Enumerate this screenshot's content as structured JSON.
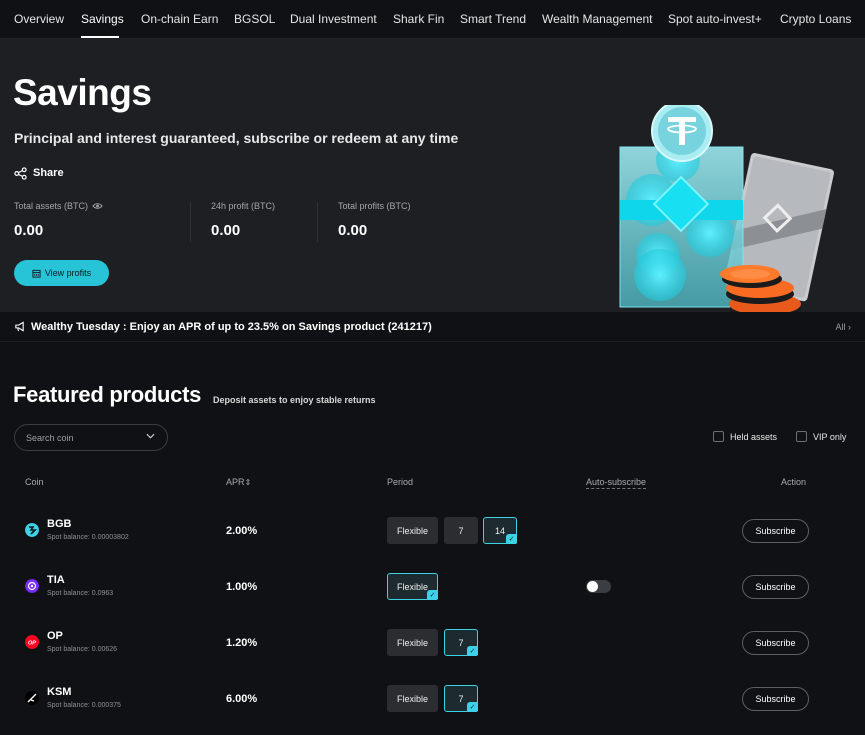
{
  "nav": {
    "items": [
      "Overview",
      "Savings",
      "On-chain Earn",
      "BGSOL",
      "Dual Investment",
      "Shark Fin",
      "Smart Trend",
      "Wealth Management",
      "Spot auto-invest+",
      "Crypto Loans"
    ],
    "active": "Savings"
  },
  "hero": {
    "title": "Savings",
    "subtitle": "Principal and interest guaranteed, subscribe or redeem at any time",
    "share_label": "Share",
    "stats": [
      {
        "label": "Total assets (BTC)",
        "value": "0.00"
      },
      {
        "label": "24h profit (BTC)",
        "value": "0.00"
      },
      {
        "label": "Total profits (BTC)",
        "value": "0.00"
      }
    ],
    "view_profits_label": "View profits"
  },
  "announcement": {
    "text": "Wealthy Tuesday : Enjoy an APR of up to 23.5% on Savings product (241217)",
    "all_label": "All"
  },
  "featured": {
    "title": "Featured products",
    "subtitle": "Deposit assets to enjoy stable returns",
    "search_placeholder": "Search coin",
    "held_assets_label": "Held assets",
    "vip_only_label": "VIP only",
    "columns": {
      "coin": "Coin",
      "apr": "APR",
      "period": "Period",
      "auto": "Auto-subscribe",
      "action": "Action"
    },
    "rows": [
      {
        "coin": "BGB",
        "balance": "Spot balance: 0.00003802",
        "apr": "2.00%",
        "periods": [
          "Flexible",
          "7",
          "14"
        ],
        "selected": "14",
        "auto_subscribe": null,
        "action": "Subscribe",
        "icon_color": "#3dd2e5"
      },
      {
        "coin": "TIA",
        "balance": "Spot balance: 0.0963",
        "apr": "1.00%",
        "periods": [
          "Flexible"
        ],
        "selected": "Flexible",
        "auto_subscribe": false,
        "action": "Subscribe",
        "icon_color": "#7b2bf9"
      },
      {
        "coin": "OP",
        "balance": "Spot balance: 0.00626",
        "apr": "1.20%",
        "periods": [
          "Flexible",
          "7"
        ],
        "selected": "7",
        "auto_subscribe": null,
        "action": "Subscribe",
        "icon_color": "#ff0420"
      },
      {
        "coin": "KSM",
        "balance": "Spot balance: 0.000375",
        "apr": "6.00%",
        "periods": [
          "Flexible",
          "7"
        ],
        "selected": "7",
        "auto_subscribe": null,
        "action": "Subscribe",
        "icon_color": "#000000"
      }
    ]
  },
  "colors": {
    "accent": "#27c3d6",
    "hero_bg": "#1d1f23",
    "page_bg": "#101114"
  }
}
